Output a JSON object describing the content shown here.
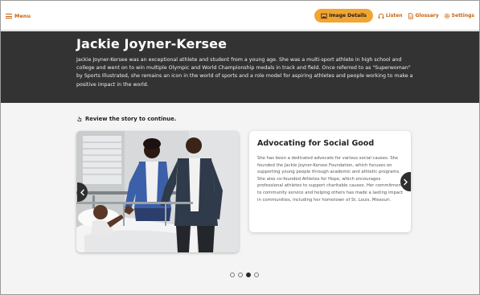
{
  "nav": {
    "menu_label": "Menu",
    "tools": [
      {
        "label": "Image Details",
        "icon": "image-icon",
        "active": true
      },
      {
        "label": "Listen",
        "icon": "headphones-icon"
      },
      {
        "label": "Glossary",
        "icon": "document-icon"
      },
      {
        "label": "Settings",
        "icon": "gear-icon"
      }
    ]
  },
  "hero": {
    "title": "Jackie Joyner-Kersee",
    "description": "Jackie Joyner-Kersee was an exceptional athlete and student from a young age. She was a multi-sport athlete in high school and college and went on to win multiple Olympic and World Championship medals in track and field. Once referred to as \"Superwoman\" by Sports Illustrated, she remains an icon in the world of sports and a role model for aspiring athletes and people working to make a positive impact in the world."
  },
  "content": {
    "instruction": "Review the story to continue.",
    "slide": {
      "title": "Advocating for Social Good",
      "body": "She has been a dedicated advocate for various social causes. She founded the Jackie Joyner-Kersee Foundation, which focuses on supporting young people through academic and athletic programs. She also co-founded Athletes for Hope, which encourages professional athletes to support charitable causes. Her commitment to community service and helping others has made a lasting impact in communities, including her hometown of St. Louis, Missouri."
    },
    "pagination": {
      "total": 4,
      "current": 3
    }
  },
  "colors": {
    "accent": "#c8620a",
    "highlight": "#f2a531",
    "hero_bg": "#333333"
  }
}
